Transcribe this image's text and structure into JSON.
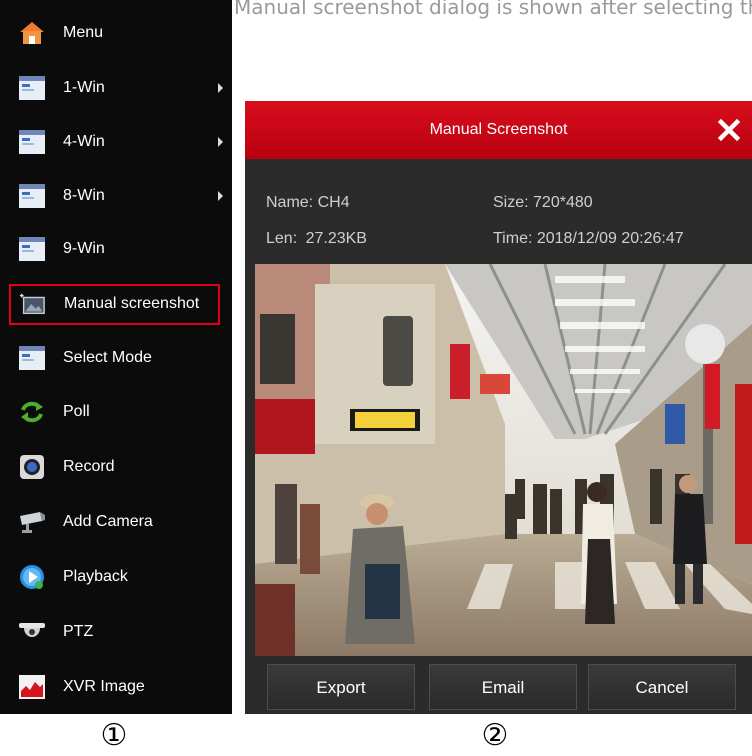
{
  "top_caption": "Manual screenshot dialog is shown after selecting the menu item",
  "menu": {
    "items": [
      {
        "label": "Menu",
        "icon": "home-icon",
        "has_submenu": false
      },
      {
        "label": "1-Win",
        "icon": "window-icon",
        "has_submenu": true
      },
      {
        "label": "4-Win",
        "icon": "window-icon",
        "has_submenu": true
      },
      {
        "label": "8-Win",
        "icon": "window-icon",
        "has_submenu": true
      },
      {
        "label": "9-Win",
        "icon": "window-icon",
        "has_submenu": false
      },
      {
        "label": "Manual screenshot",
        "icon": "screenshot-icon",
        "has_submenu": false,
        "highlighted": true
      },
      {
        "label": "Select Mode",
        "icon": "window-icon",
        "has_submenu": false
      },
      {
        "label": "Poll",
        "icon": "refresh-icon",
        "has_submenu": false
      },
      {
        "label": "Record",
        "icon": "record-icon",
        "has_submenu": false
      },
      {
        "label": "Add Camera",
        "icon": "camera-icon",
        "has_submenu": false
      },
      {
        "label": "Playback",
        "icon": "play-icon",
        "has_submenu": false
      },
      {
        "label": "PTZ",
        "icon": "dome-camera-icon",
        "has_submenu": false
      },
      {
        "label": "XVR Image",
        "icon": "chart-icon",
        "has_submenu": false
      }
    ]
  },
  "dialog": {
    "title": "Manual Screenshot",
    "name_label": "Name:",
    "name_value": "CH4",
    "size_label": "Size:",
    "size_value": "720*480",
    "len_label": "Len:",
    "len_value": "27.23KB",
    "time_label": "Time:",
    "time_value": "2018/12/09 20:26:47",
    "buttons": {
      "export": "Export",
      "email": "Email",
      "cancel": "Cancel"
    }
  },
  "captions": {
    "left": "①",
    "right": "②"
  },
  "colors": {
    "accent_red": "#d80e1e",
    "menu_bg": "#0b0b0b",
    "dialog_bg": "#2b2b2b",
    "highlight_border": "#e0001b"
  }
}
